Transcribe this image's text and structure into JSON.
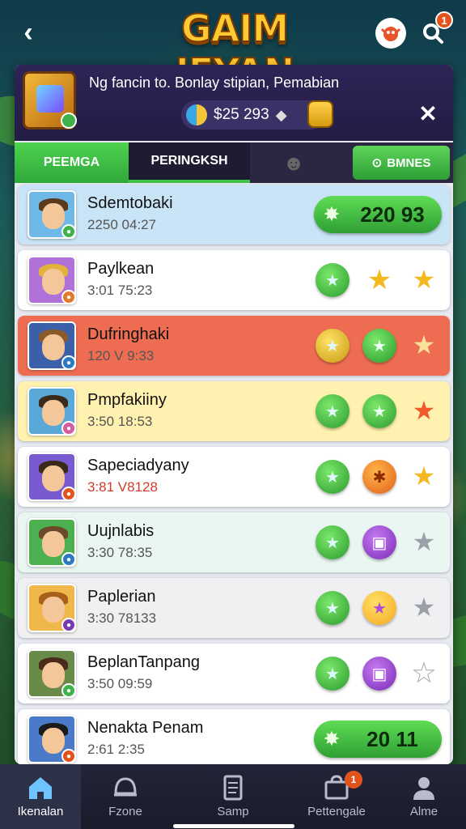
{
  "header": {
    "back_glyph": "‹",
    "logo_text": "GAIM IEYAN",
    "notification_count": "1"
  },
  "banner": {
    "message": "Ng fancin to. Bonlay stipian, Pemabian",
    "currency": "$25 293"
  },
  "tabs": [
    {
      "label": "PEEMGA"
    },
    {
      "label": "PERINGKSH"
    },
    {
      "label": ""
    },
    {
      "label": "BMNES"
    }
  ],
  "rows": [
    {
      "name": "Sdemtobaki",
      "time": "2250 04:27",
      "score": "220 93",
      "bg": "#c9e4f6",
      "avatar_bg": "#6fb8e8",
      "hair": "#5a3a1c",
      "mini": "#3fb24a",
      "star_color": ""
    },
    {
      "name": "Paylkean",
      "time": "3:01 75:23",
      "bg": "#ffffff",
      "avatar_bg": "#b072d8",
      "hair": "#e2b33a",
      "mini": "#e27a2a",
      "star_color": "#f5b920"
    },
    {
      "name": "Dufringhaki",
      "time": "120 V 9:33",
      "bg": "#ee6d52",
      "avatar_bg": "#3b5fa8",
      "hair": "#8a5a2a",
      "mini": "#2a7ac2",
      "star_color": "#fbe29a"
    },
    {
      "name": "Pmpfakiiny",
      "time": "3:50 18:53",
      "bg": "#fff2b0",
      "avatar_bg": "#59a8d8",
      "hair": "#3a2a1a",
      "mini": "#d85aa0",
      "star_color": "#f05a2a"
    },
    {
      "name": "Sapeciadyany",
      "time": "3:81 V8128",
      "bg": "#ffffff",
      "avatar_bg": "#7a5ad0",
      "hair": "#3a2a1a",
      "mini": "#e2541c",
      "star_color": "#f5b920"
    },
    {
      "name": "Uujnlabis",
      "time": "3:30 78:35",
      "bg": "#eaf6f2",
      "avatar_bg": "#4caf50",
      "hair": "#6a4a2a",
      "mini": "#2a7ac2",
      "star_color": "#9aa0a8"
    },
    {
      "name": "Paplerian",
      "time": "3:30 78133",
      "bg": "#f0f0f2",
      "avatar_bg": "#f0b84a",
      "hair": "#a8601a",
      "mini": "#7a3ab0",
      "star_color": "#9aa0a8"
    },
    {
      "name": "BeplanTanpang",
      "time": "3:50 09:59",
      "bg": "#ffffff",
      "avatar_bg": "#6a8a4a",
      "hair": "#4a2a1a",
      "mini": "#3fb24a",
      "star_color": "#ffffff"
    },
    {
      "name": "Nenakta Penam",
      "time": "2:61 2:35",
      "score": "20 11",
      "bg": "#ffffff",
      "avatar_bg": "#4a7ac8",
      "hair": "#1a1a1a",
      "mini": "#e2541c",
      "star_color": ""
    }
  ],
  "nav": [
    {
      "label": "Ikenalan"
    },
    {
      "label": "Fzone"
    },
    {
      "label": "Samp"
    },
    {
      "label": "Pettengale",
      "badge": "1"
    },
    {
      "label": "Alme"
    }
  ]
}
